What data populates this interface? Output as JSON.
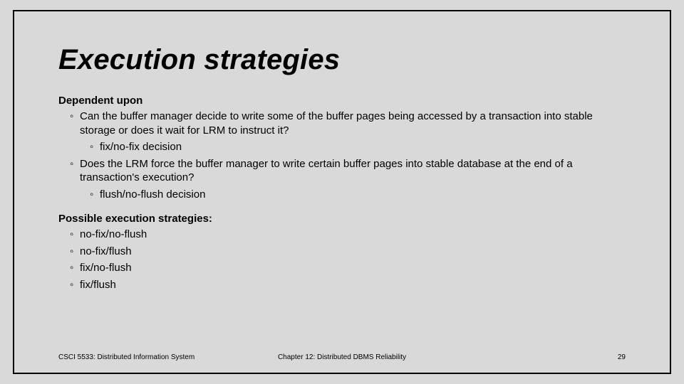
{
  "title": "Execution strategies",
  "sections": [
    {
      "heading": "Dependent upon",
      "items": [
        {
          "text": "Can the buffer manager decide to write some of the buffer pages being accessed by a transaction into stable storage or does it wait for LRM to instruct it?",
          "sub": [
            "fix/no-fix decision"
          ]
        },
        {
          "text": "Does the LRM force the buffer manager to write certain buffer pages into stable database at the end of a transaction's execution?",
          "sub": [
            "flush/no-flush decision"
          ]
        }
      ]
    },
    {
      "heading": "Possible execution strategies:",
      "items": [
        {
          "text": "no-fix/no-flush",
          "sub": []
        },
        {
          "text": "no-fix/flush",
          "sub": []
        },
        {
          "text": "fix/no-flush",
          "sub": []
        },
        {
          "text": "fix/flush",
          "sub": []
        }
      ]
    }
  ],
  "footer": {
    "left": "CSCI 5533: Distributed Information System",
    "center": "Chapter 12: Distributed DBMS Reliability",
    "right": "29"
  }
}
